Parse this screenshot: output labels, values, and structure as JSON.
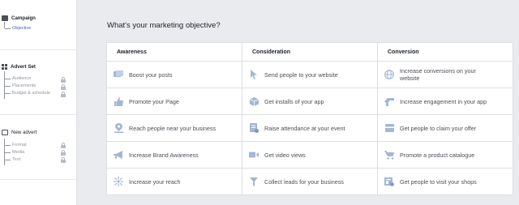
{
  "sidebar": {
    "sections": [
      {
        "title": "Campaign",
        "icon": "campaign-icon",
        "items": [
          {
            "label": "Objective",
            "active": true,
            "locked": false
          }
        ]
      },
      {
        "title": "Advert Set",
        "icon": "advert-set-grid-icon",
        "items": [
          {
            "label": "Audience",
            "locked": true
          },
          {
            "label": "Placements",
            "locked": true
          },
          {
            "label": "Budget & schedule",
            "locked": true
          }
        ]
      },
      {
        "title": "New advert",
        "icon": "advert-icon",
        "items": [
          {
            "label": "Format",
            "locked": true
          },
          {
            "label": "Media",
            "locked": true
          },
          {
            "label": "Text",
            "locked": true
          }
        ]
      }
    ]
  },
  "main": {
    "title": "What's your marketing objective?",
    "columns": [
      {
        "heading": "Awareness",
        "items": [
          {
            "label": "Boost your posts",
            "icon": "boost-posts-icon"
          },
          {
            "label": "Promote your Page",
            "icon": "thumbs-up-icon"
          },
          {
            "label": "Reach people near your business",
            "icon": "location-pin-icon"
          },
          {
            "label": "Increase Brand Awareness",
            "icon": "megaphone-icon"
          },
          {
            "label": "Increase your reach",
            "icon": "reach-icon"
          }
        ]
      },
      {
        "heading": "Consideration",
        "items": [
          {
            "label": "Send people to your website",
            "icon": "cursor-icon"
          },
          {
            "label": "Get installs of your app",
            "icon": "app-box-icon"
          },
          {
            "label": "Raise attendance at your event",
            "icon": "event-icon"
          },
          {
            "label": "Get video views",
            "icon": "video-camera-icon"
          },
          {
            "label": "Collect leads for your business",
            "icon": "funnel-icon"
          }
        ]
      },
      {
        "heading": "Conversion",
        "items": [
          {
            "label": "Increase conversions on your website",
            "icon": "globe-icon"
          },
          {
            "label": "Increase engagement in your app",
            "icon": "app-engagement-icon"
          },
          {
            "label": "Get people to claim your offer",
            "icon": "offer-icon"
          },
          {
            "label": "Promote a product catalogue",
            "icon": "cart-icon"
          },
          {
            "label": "Get people to visit your shops",
            "icon": "shop-icon"
          }
        ]
      }
    ]
  },
  "colors": {
    "accent": "#4267b2",
    "icon": "#a4b6d6",
    "text": "#4b4f56",
    "background": "#e9ebee"
  }
}
